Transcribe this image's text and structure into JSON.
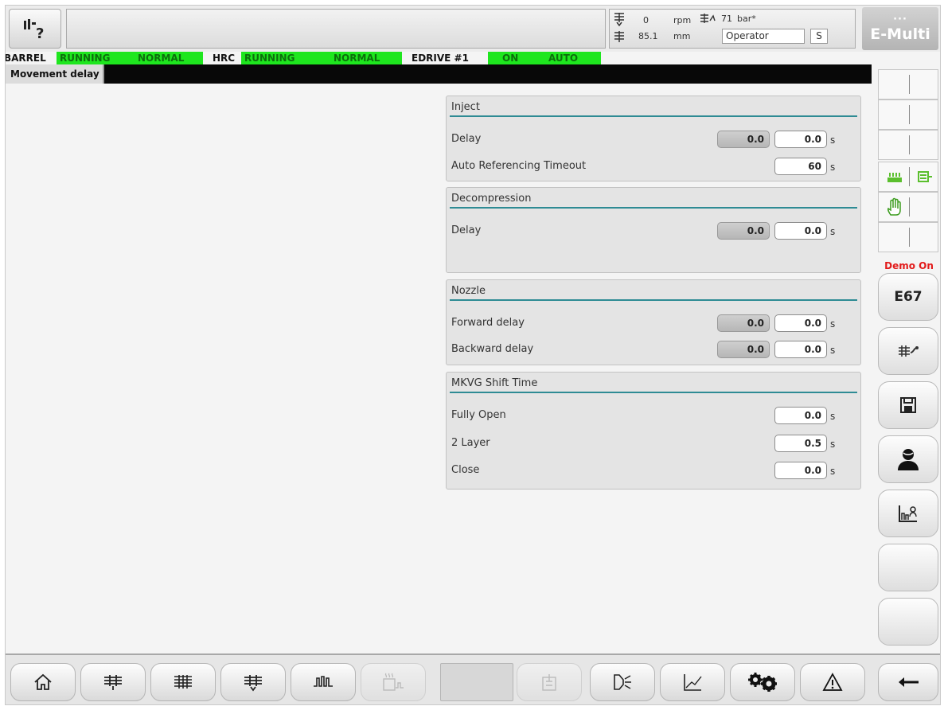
{
  "header": {
    "help_icon": "help-question-icon",
    "readouts": {
      "screw_speed": "0",
      "screw_speed_unit": "rpm",
      "screw_position": "85.1",
      "screw_position_unit": "mm",
      "pressure": "71",
      "pressure_unit": "bar*",
      "user": "Operator",
      "access_level": "S"
    },
    "logo": {
      "top": "···",
      "main": "E-Multi"
    }
  },
  "status_bar": [
    {
      "label": "BARREL",
      "state": "RUNNING",
      "mode": "NORMAL"
    },
    {
      "label": "HRC",
      "state": "RUNNING",
      "mode": "NORMAL"
    },
    {
      "label": "EDRIVE #1",
      "state": "ON",
      "mode": "AUTO"
    }
  ],
  "page": {
    "title": "Movement delay"
  },
  "panels": {
    "inject": {
      "title": "Inject",
      "delay": {
        "label": "Delay",
        "actual": "0.0",
        "set": "0.0",
        "unit": "s"
      },
      "timeout": {
        "label": "Auto Referencing Timeout",
        "set": "60",
        "unit": "s"
      }
    },
    "decompression": {
      "title": "Decompression",
      "delay": {
        "label": "Delay",
        "actual": "0.0",
        "set": "0.0",
        "unit": "s"
      }
    },
    "nozzle": {
      "title": "Nozzle",
      "forward": {
        "label": "Forward delay",
        "actual": "0.0",
        "set": "0.0",
        "unit": "s"
      },
      "backward": {
        "label": "Backward delay",
        "actual": "0.0",
        "set": "0.0",
        "unit": "s"
      }
    },
    "mkvg": {
      "title": "MKVG Shift Time",
      "fully_open": {
        "label": "Fully Open",
        "set": "0.0",
        "unit": "s"
      },
      "two_layer": {
        "label": "2 Layer",
        "set": "0.5",
        "unit": "s"
      },
      "close": {
        "label": "Close",
        "set": "0.0",
        "unit": "s"
      }
    }
  },
  "sidebar": {
    "demo_label": "Demo On",
    "error_code": "E67",
    "icons": [
      "heater-icon",
      "conveyor-icon",
      "manual-hand-icon",
      "screw-service-icon",
      "save-icon",
      "user-icon",
      "chart-user-icon"
    ]
  },
  "bottom_bar": {
    "icons": [
      "home-icon",
      "injection-unit-icon",
      "barrel-icon",
      "screw-icon",
      "heating-zones-icon",
      "hot-runner-icon",
      "empty-icon",
      "ejector-icon",
      "nozzle-icon",
      "trend-icon",
      "settings-icon",
      "alarm-icon",
      "back-arrow-icon"
    ]
  },
  "colors": {
    "status_green": "#1ee61e",
    "accent_teal": "#2e8b94",
    "demo_red": "#e21a1a",
    "title_bar": "#080808"
  }
}
